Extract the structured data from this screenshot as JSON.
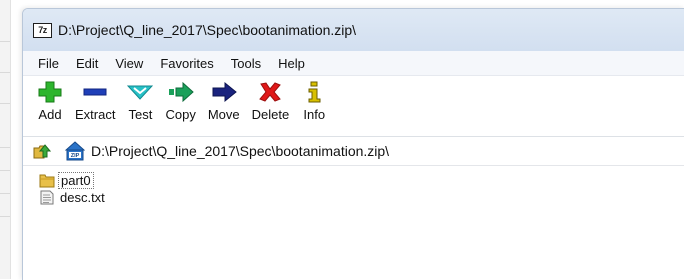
{
  "window": {
    "title": "D:\\Project\\Q_line_2017\\Spec\\bootanimation.zip\\",
    "app_icon_text": "7z"
  },
  "menu": [
    "File",
    "Edit",
    "View",
    "Favorites",
    "Tools",
    "Help"
  ],
  "toolbar": [
    {
      "label": "Add",
      "icon": "plus-icon",
      "color": "#2db52d"
    },
    {
      "label": "Extract",
      "icon": "minus-icon",
      "color": "#1f3fb8"
    },
    {
      "label": "Test",
      "icon": "check-icon",
      "color": "#27c0c6"
    },
    {
      "label": "Copy",
      "icon": "double-arrow-icon",
      "color": "#1aa05a"
    },
    {
      "label": "Move",
      "icon": "arrow-right-icon",
      "color": "#1a237e"
    },
    {
      "label": "Delete",
      "icon": "x-icon",
      "color": "#e01818"
    },
    {
      "label": "Info",
      "icon": "info-icon",
      "color": "#d8c000"
    }
  ],
  "address": {
    "path": "D:\\Project\\Q_line_2017\\Spec\\bootanimation.zip\\"
  },
  "files": [
    {
      "name": "part0",
      "type": "folder",
      "selected": true
    },
    {
      "name": "desc.txt",
      "type": "file",
      "selected": false
    }
  ]
}
